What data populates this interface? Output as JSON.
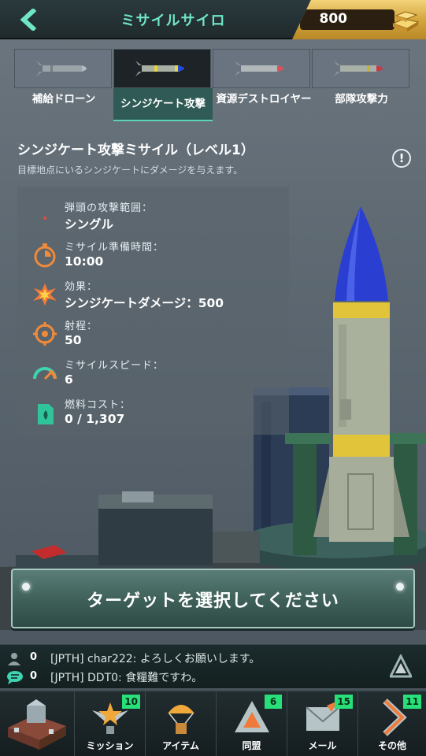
{
  "header": {
    "title": "ミサイルサイロ",
    "gold": "800"
  },
  "tabs": [
    {
      "label": "補給ドローン",
      "active": false
    },
    {
      "label": "シンジケート攻撃",
      "active": true
    },
    {
      "label": "資源デストロイヤー",
      "active": false
    },
    {
      "label": "部隊攻撃力",
      "active": false
    }
  ],
  "missile": {
    "title": "シンジケート攻撃ミサイル（レベル1）",
    "description": "目標地点にいるシンジケートにダメージを与えます。",
    "info_label": "!"
  },
  "stats": [
    {
      "label": "弾頭の攻撃範囲：",
      "value": "シングル"
    },
    {
      "label": "ミサイル準備時間：",
      "value": "10:00"
    },
    {
      "label": "効果：",
      "value": "シンジケートダメージ：500"
    },
    {
      "label": "射程：",
      "value": "50"
    },
    {
      "label": "ミサイルスピード：",
      "value": "6"
    },
    {
      "label": "燃料コスト：",
      "value": "0 / 1,307"
    }
  ],
  "target_button": {
    "label": "ターゲットを選択してください"
  },
  "chat": {
    "rows": [
      {
        "count": "0",
        "text": "[JPTH] char222: よろしくお願いします。"
      },
      {
        "count": "0",
        "text": "[JPTH] DDT0: 食糧難ですわ。"
      }
    ]
  },
  "nav": [
    {
      "label": "",
      "badge": ""
    },
    {
      "label": "ミッション",
      "badge": "10"
    },
    {
      "label": "アイテム",
      "badge": ""
    },
    {
      "label": "同盟",
      "badge": "6"
    },
    {
      "label": "メール",
      "badge": "15"
    },
    {
      "label": "その他",
      "badge": "11"
    }
  ],
  "colors": {
    "accent": "#6fe6c8",
    "badge": "#27e07a",
    "gold": "#d4a63c"
  }
}
